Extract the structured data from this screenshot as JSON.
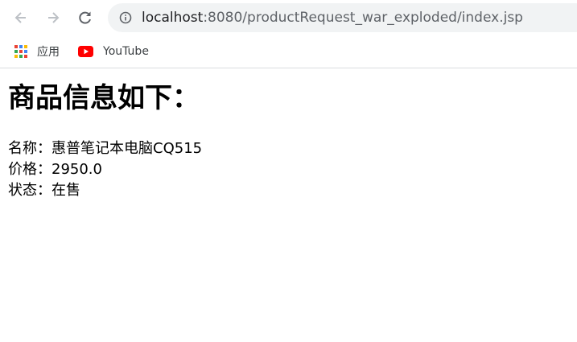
{
  "browser": {
    "url_host": "localhost",
    "url_rest": ":8080/productRequest_war_exploded/index.jsp",
    "bookmarks": [
      {
        "label": "应用",
        "icon": "apps-grid-icon"
      },
      {
        "label": "YouTube",
        "icon": "youtube-icon"
      }
    ]
  },
  "page": {
    "heading": "商品信息如下：",
    "lines": [
      {
        "label": "名称：",
        "value": "惠普笔记本电脑CQ515"
      },
      {
        "label": "价格：",
        "value": "2950.0"
      },
      {
        "label": "状态：",
        "value": "在售"
      }
    ]
  },
  "colors": {
    "omnibox_bg": "#f1f3f4",
    "youtube_red": "#ff0000"
  }
}
